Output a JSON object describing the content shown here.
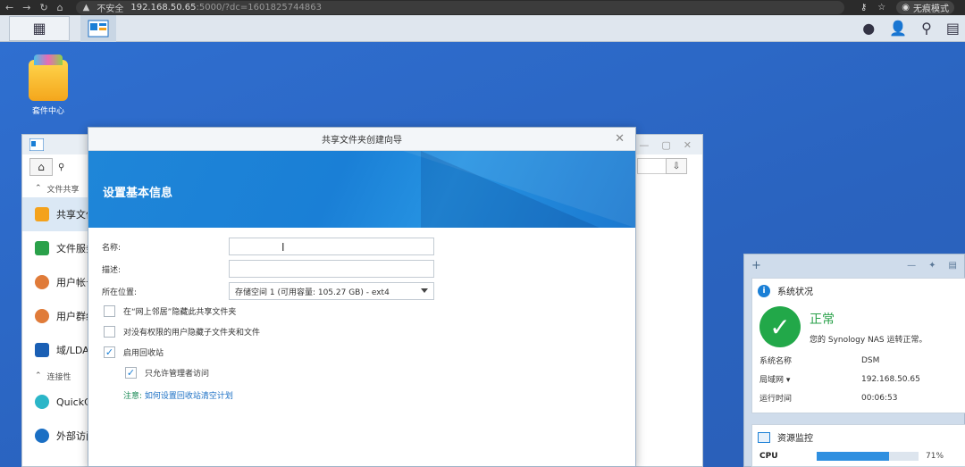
{
  "browser": {
    "insecure_label": "不安全",
    "url_host": "192.168.50.65",
    "url_rest": ":5000/?dc=1601825744863",
    "incognito_label": "无痕模式"
  },
  "desktop": {
    "icons": [
      {
        "label": "套件中心",
        "icon": "package-center-icon"
      }
    ]
  },
  "control_panel": {
    "sections": [
      {
        "label": "文件共享",
        "items": [
          {
            "label": "共享文件夹",
            "icon": "shared-folder-icon",
            "color": "#f4a21c"
          },
          {
            "label": "文件服务",
            "icon": "file-services-icon",
            "color": "#2aa14a"
          },
          {
            "label": "用户帐号",
            "icon": "user-icon",
            "color": "#e07b39"
          },
          {
            "label": "用户群组",
            "icon": "group-icon",
            "color": "#e07b39"
          },
          {
            "label": "域/LDAP",
            "icon": "domain-icon",
            "color": "#1a5fb4"
          }
        ]
      },
      {
        "label": "连接性",
        "items": [
          {
            "label": "QuickConnect",
            "icon": "quickconnect-icon",
            "color": "#2bb6c8"
          },
          {
            "label": "外部访问",
            "icon": "globe-icon",
            "color": "#1a6fc4"
          }
        ]
      }
    ]
  },
  "wizard": {
    "title": "共享文件夹创建向导",
    "heading": "设置基本信息",
    "fields": {
      "name_label": "名称:",
      "name_value": "",
      "desc_label": "描述:",
      "desc_value": "",
      "location_label": "所在位置:",
      "location_value": "存储空间 1 (可用容量: 105.27 GB) - ext4"
    },
    "options": [
      {
        "label": "在“网上邻居”隐藏此共享文件夹",
        "checked": false
      },
      {
        "label": "对没有权限的用户隐藏子文件夹和文件",
        "checked": false
      },
      {
        "label": "启用回收站",
        "checked": true
      },
      {
        "label": "只允许管理者访问",
        "checked": true
      }
    ],
    "note_key": "注意:",
    "note_link": "如何设置回收站清空计划"
  },
  "widget": {
    "system_title": "系统状况",
    "status_big": "正常",
    "status_text": "您的 Synology NAS 运转正常。",
    "rows": [
      {
        "k": "系统名称",
        "v": "DSM"
      },
      {
        "k": "局域网 ▾",
        "v": "192.168.50.65"
      },
      {
        "k": "运行时间",
        "v": "00:06:53"
      }
    ],
    "monitor_title": "资源监控",
    "cpu_label": "CPU",
    "cpu_percent": 71,
    "cpu_text": "71%"
  }
}
